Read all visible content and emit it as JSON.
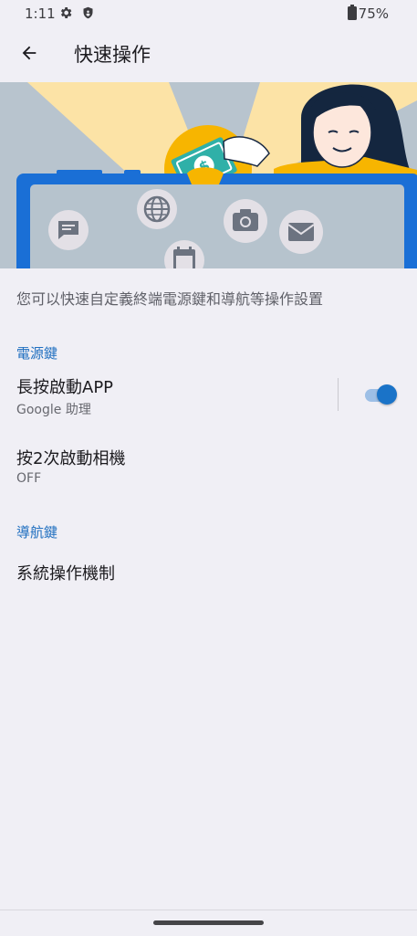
{
  "status_bar": {
    "time": "1:11",
    "battery": "75%",
    "icons": [
      "gear-icon",
      "shield-icon",
      "battery-icon"
    ]
  },
  "app_bar": {
    "title": "快速操作",
    "back_icon": "arrow-back-icon"
  },
  "hero": {
    "illustration": "woman-holding-money-card-phone-illustration",
    "icons": [
      "message-icon",
      "globe-icon",
      "camera-icon",
      "mail-icon",
      "calendar-icon",
      "dollar-card-icon"
    ]
  },
  "description": "您可以快速自定義終端電源鍵和導航等操作設置",
  "sections": [
    {
      "header": "電源鍵",
      "items": [
        {
          "title": "長按啟動APP",
          "summary": "Google 助理",
          "switch_on": true
        },
        {
          "title": "按2次啟動相機",
          "summary": "OFF"
        }
      ]
    },
    {
      "header": "導航鍵",
      "items": [
        {
          "title": "系統操作機制"
        }
      ]
    }
  ],
  "colors": {
    "accent": "#1a73c8",
    "section_header": "#1f6fc0",
    "background": "#f0eff5"
  }
}
